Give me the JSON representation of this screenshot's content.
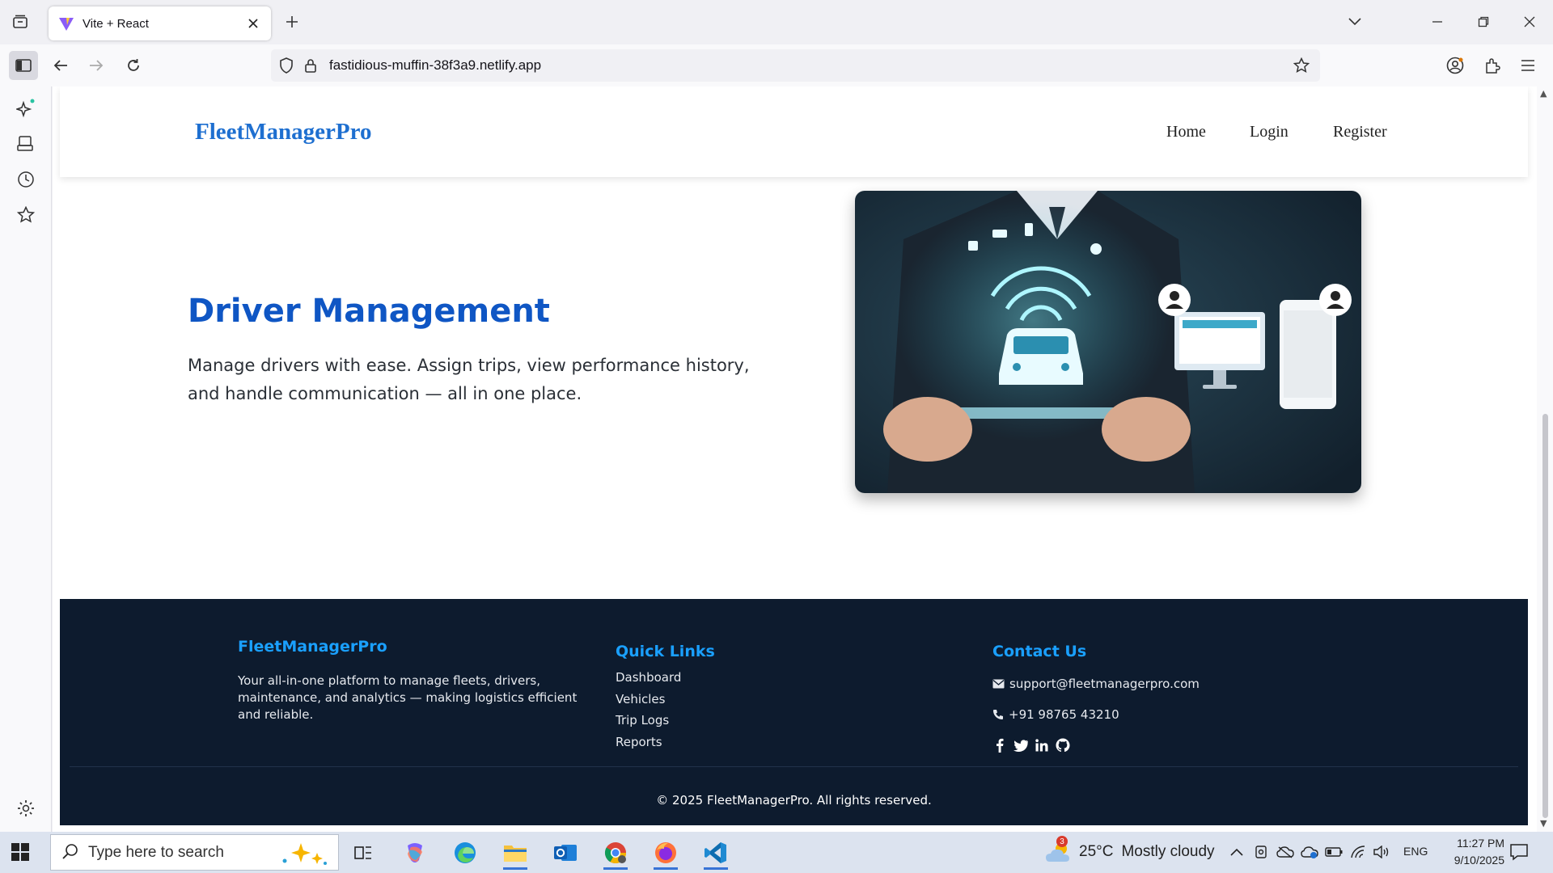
{
  "browser": {
    "tab_title": "Vite + React",
    "url": "fastidious-muffin-38f3a9.netlify.app"
  },
  "site": {
    "brand": "FleetManagerPro",
    "nav": [
      "Home",
      "Login",
      "Register"
    ]
  },
  "hero": {
    "title": "Driver Management",
    "text": "Manage drivers with ease. Assign trips, view performance history, and handle communication — all in one place."
  },
  "footer": {
    "brand": "FleetManagerPro",
    "description": "Your all-in-one platform to manage fleets, drivers, maintenance, and analytics — making logistics efficient and reliable.",
    "quick_links_title": "Quick Links",
    "quick_links": [
      "Dashboard",
      "Vehicles",
      "Trip Logs",
      "Reports"
    ],
    "contact_title": "Contact Us",
    "email": "support@fleetmanagerpro.com",
    "phone": "+91 98765 43210",
    "copyright": "© 2025 FleetManagerPro. All rights reserved."
  },
  "taskbar": {
    "search_placeholder": "Type here to search",
    "weather_temp": "25°C",
    "weather_text": "Mostly cloudy",
    "weather_badge": "3",
    "language": "ENG",
    "time": "11:27 PM",
    "date": "9/10/2025"
  },
  "colors": {
    "brand_blue": "#1e6fd0",
    "hero_title": "#0f56c4",
    "footer_bg": "#0d1b2e",
    "footer_accent": "#1aa0ff"
  }
}
